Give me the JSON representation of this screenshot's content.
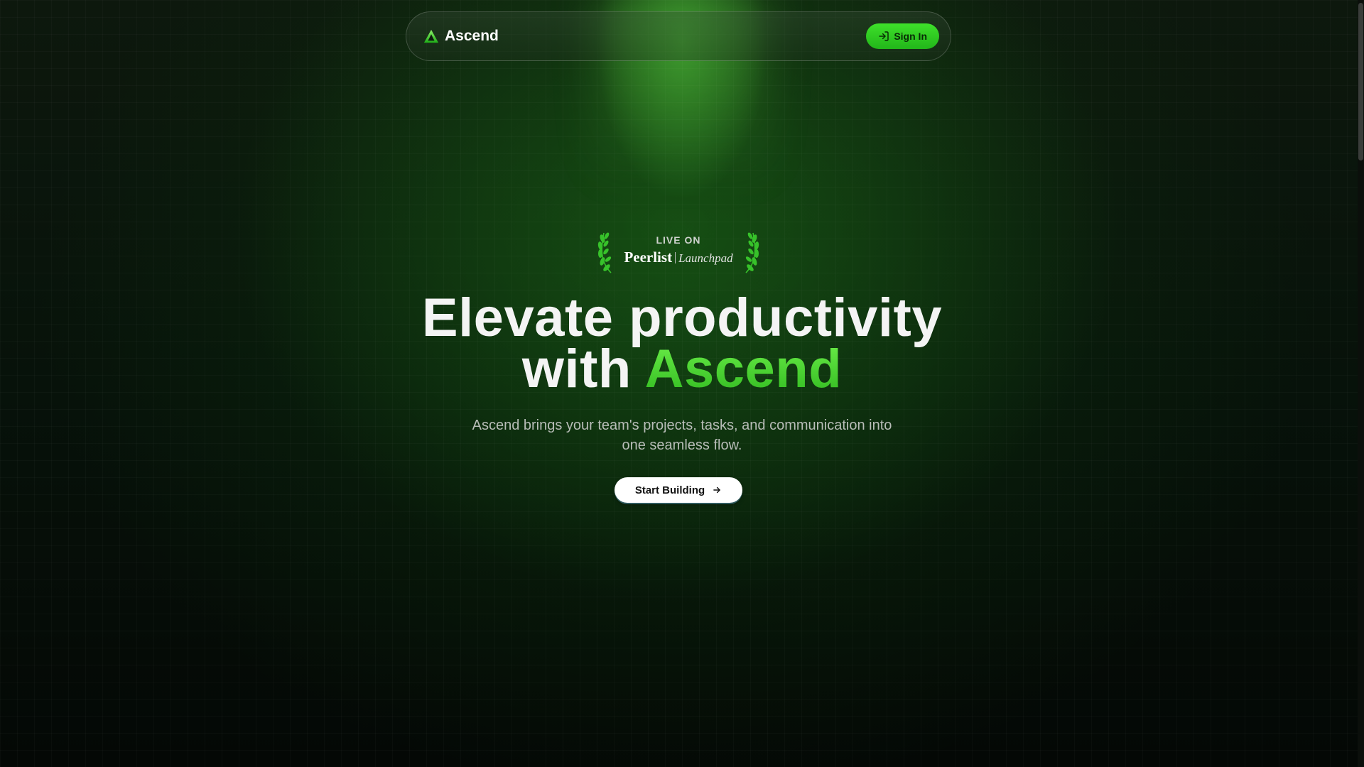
{
  "navbar": {
    "brand_name": "Ascend",
    "signin_label": "Sign In",
    "signin_icon": "log-in-icon",
    "logo_icon": "triangle-logo-icon"
  },
  "badge": {
    "top": "LIVE ON",
    "brand": "Peerlist",
    "sub": "Launchpad",
    "icon": "laurel-icon"
  },
  "hero": {
    "headline_line1": "Elevate productivity",
    "headline_line2_prefix": "with ",
    "headline_accent": "Ascend",
    "subtext": "Ascend brings your team's projects, tasks, and communication into one seamless flow.",
    "cta_label": "Start Building",
    "cta_icon": "arrow-right-icon"
  },
  "colors": {
    "accent": "#3ee02a",
    "background": "#050a05",
    "text": "#f4f4f4",
    "muted_text": "#b8bdb8"
  }
}
